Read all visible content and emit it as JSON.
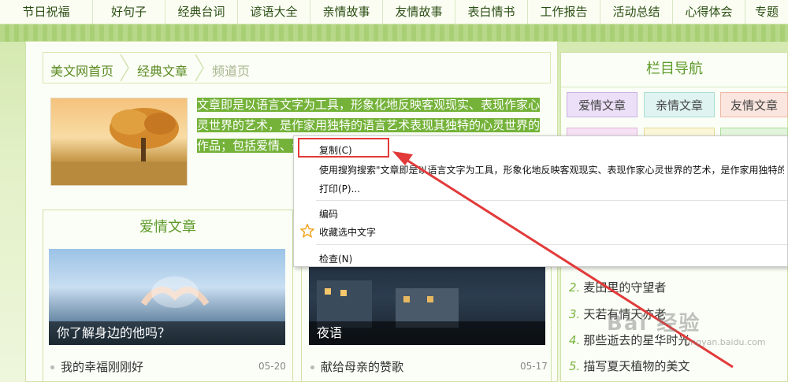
{
  "top_nav": [
    "节日祝福",
    "好句子",
    "经典台词",
    "谚语大全",
    "亲情故事",
    "友情故事",
    "表白情书",
    "工作报告",
    "活动总结",
    "心得体会",
    "专题"
  ],
  "breadcrumb": {
    "home": "美文网首页",
    "section": "经典文章",
    "current": "频道页"
  },
  "selected_text": "文章即是以语言文字为工具，形象化地反映客观现实、表现作家心灵世界的艺术，是作家用独特的语言艺术表现其独特的心灵世界的作品；包括爱情、亲情章，是文化的重要表内心情感，再现一定",
  "love_section": {
    "title": "爱情文章",
    "cards": [
      {
        "caption": "你了解身边的他吗？"
      },
      {
        "caption": "夜语"
      }
    ],
    "list": [
      {
        "title": "我的幸福刚刚好",
        "date": "05-20"
      },
      {
        "title": "献给母亲的赞歌",
        "date": "05-17"
      }
    ]
  },
  "column_nav": {
    "title": "栏目导航",
    "tags": [
      "爱情文章",
      "亲情文章",
      "友情文章",
      "",
      "",
      ""
    ],
    "list": [
      {
        "n": "2.",
        "title": "麦田里的守望者"
      },
      {
        "n": "3.",
        "title": "天若有情天亦老"
      },
      {
        "n": "4.",
        "title": "那些逝去的星华时光"
      },
      {
        "n": "5.",
        "title": "描写夏天植物的美文"
      }
    ]
  },
  "context_menu": {
    "copy": "复制(C)",
    "search": "使用搜狗搜索\"文章即是以语言文字为工具，形象化地反映客观现实、表现作家心灵世界的艺术，是作家用独特的语",
    "print": "打印(P)...",
    "encoding": "编码",
    "favorite": "收藏选中文字",
    "inspect": "检查(N)"
  },
  "watermark": {
    "text": "Bai 经验",
    "sub": "jingyan.baidu.com"
  },
  "colors": {
    "accent": "#5e9a2a",
    "selection": "#74b239",
    "highlight_box": "#e23a3a",
    "arrow": "#e23a3a"
  }
}
